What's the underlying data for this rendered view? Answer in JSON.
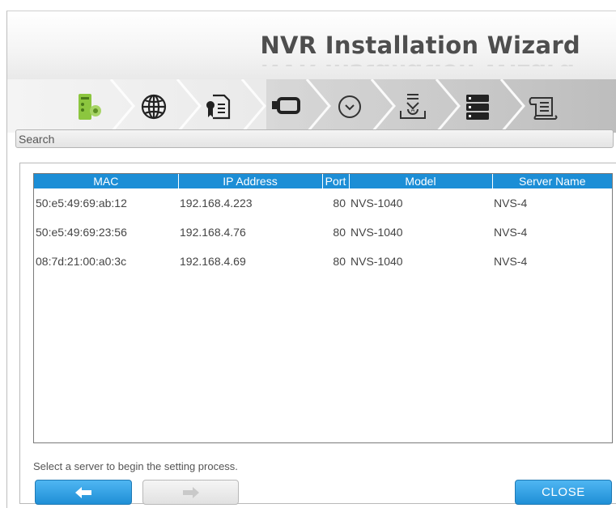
{
  "header": {
    "title": "NVR Installation Wizard"
  },
  "steps": [
    {
      "icon": "nvr-device-icon",
      "active": true
    },
    {
      "icon": "globe-icon",
      "active": false
    },
    {
      "icon": "license-icon",
      "active": false
    },
    {
      "icon": "hard-drive-icon",
      "active": false
    },
    {
      "icon": "clock-icon",
      "active": false
    },
    {
      "icon": "install-icon",
      "active": false
    },
    {
      "icon": "server-list-icon",
      "active": false
    },
    {
      "icon": "summary-icon",
      "active": false
    }
  ],
  "search": {
    "label": "Search"
  },
  "table": {
    "columns": [
      "MAC",
      "IP Address",
      "Port",
      "Model",
      "Server Name"
    ],
    "rows": [
      [
        "50:e5:49:69:ab:12",
        "192.168.4.223",
        "80",
        "NVS-1040",
        "NVS-4"
      ],
      [
        "50:e5:49:69:23:56",
        "192.168.4.76",
        "80",
        "NVS-1040",
        "NVS-4"
      ],
      [
        "08:7d:21:00:a0:3c",
        "192.168.4.69",
        "80",
        "NVS-1040",
        "NVS-4"
      ]
    ]
  },
  "hint": "Select a server to begin the setting process.",
  "buttons": {
    "back_icon": "arrow-left-icon",
    "next_icon": "arrow-right-icon",
    "close_label": "CLOSE"
  },
  "colors": {
    "accent": "#1c8ed6",
    "active_step": "#8cc63f",
    "title": "#4e4e4e"
  }
}
